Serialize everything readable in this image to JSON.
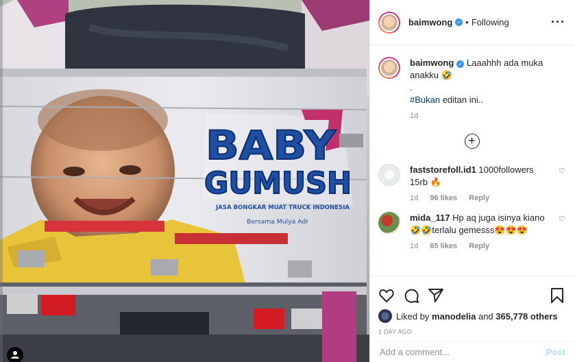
{
  "post": {
    "username": "baimwong",
    "follow_state": "Following",
    "separator": "•",
    "more_icon": "more-horizontal-icon"
  },
  "photo": {
    "sign_line1": "BABY",
    "sign_line2": "GUMUSH",
    "sign_small": "JASA BONGKAR MUAT TRUCK INDONESIA",
    "sign_small2": "Bersama Mulya Adr"
  },
  "caption": {
    "username": "baimwong",
    "text": "Laaahhh ada muka anakku 🤣",
    "dot": ".",
    "hashtag": "#Bukan",
    "hashtag_rest": " editan ini..",
    "time": "1d"
  },
  "load_more_icon": "plus-circle-icon",
  "comments": [
    {
      "username": "faststorefoll.id1",
      "text": "1000followers 15rb 🔥",
      "time": "1d",
      "likes": "96 likes",
      "reply": "Reply"
    },
    {
      "username": "mida_117",
      "text": "Hp aq juga isinya kiano 🤣🤣terlalu gemesss😍😍😍",
      "time": "1d",
      "likes": "65 likes",
      "reply": "Reply"
    }
  ],
  "actions": {
    "liked_by_prefix": "Liked by ",
    "liked_by_user": "manodelia",
    "liked_by_and": " and ",
    "others": "365,778 others",
    "time_ago": "1 DAY AGO"
  },
  "add_comment": {
    "placeholder": "Add a comment...",
    "post_label": "Post"
  },
  "colors": {
    "link": "#00376b",
    "verified": "#3897f0",
    "post_disabled": "#b2dffc",
    "muted": "#8e8e8e"
  }
}
